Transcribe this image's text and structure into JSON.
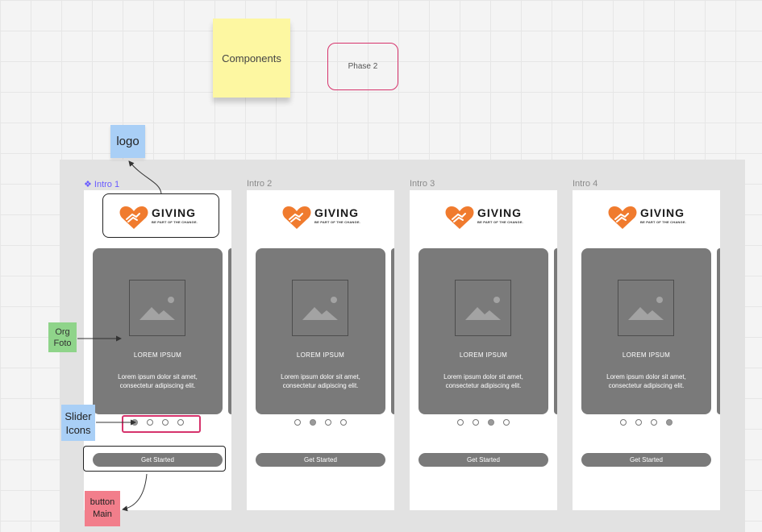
{
  "stickies": {
    "components": "Components",
    "phase": "Phase 2",
    "logo": "logo",
    "org_line1": "Org",
    "org_line2": "Foto",
    "slider_line1": "Slider",
    "slider_line2": "Icons",
    "button_line1": "button",
    "button_line2": "Main"
  },
  "brand": {
    "name": "GIVING",
    "tagline": "BE PART OF THE CHANGE.",
    "heart_color": "#f07b2e"
  },
  "frames": [
    {
      "label": "❖ Intro 1",
      "title": "LOREM IPSUM",
      "body": "Lorem ipsum dolor sit amet, consectetur adipiscing elit.",
      "button": "Get Started",
      "active_dot": 0
    },
    {
      "label": "Intro 2",
      "title": "LOREM IPSUM",
      "body": "Lorem ipsum dolor sit amet, consectetur adipiscing elit.",
      "button": "Get Started",
      "active_dot": 1
    },
    {
      "label": "Intro 3",
      "title": "LOREM IPSUM",
      "body": "Lorem ipsum dolor sit amet, consectetur adipiscing elit.",
      "button": "Get Started",
      "active_dot": 2
    },
    {
      "label": "Intro 4",
      "title": "LOREM IPSUM",
      "body": "Lorem ipsum dolor sit amet, consectetur adipiscing elit.",
      "button": "Get Started",
      "active_dot": 3
    }
  ],
  "colors": {
    "highlight_pink": "#d6336c",
    "card_gray": "#7a7a7a"
  }
}
